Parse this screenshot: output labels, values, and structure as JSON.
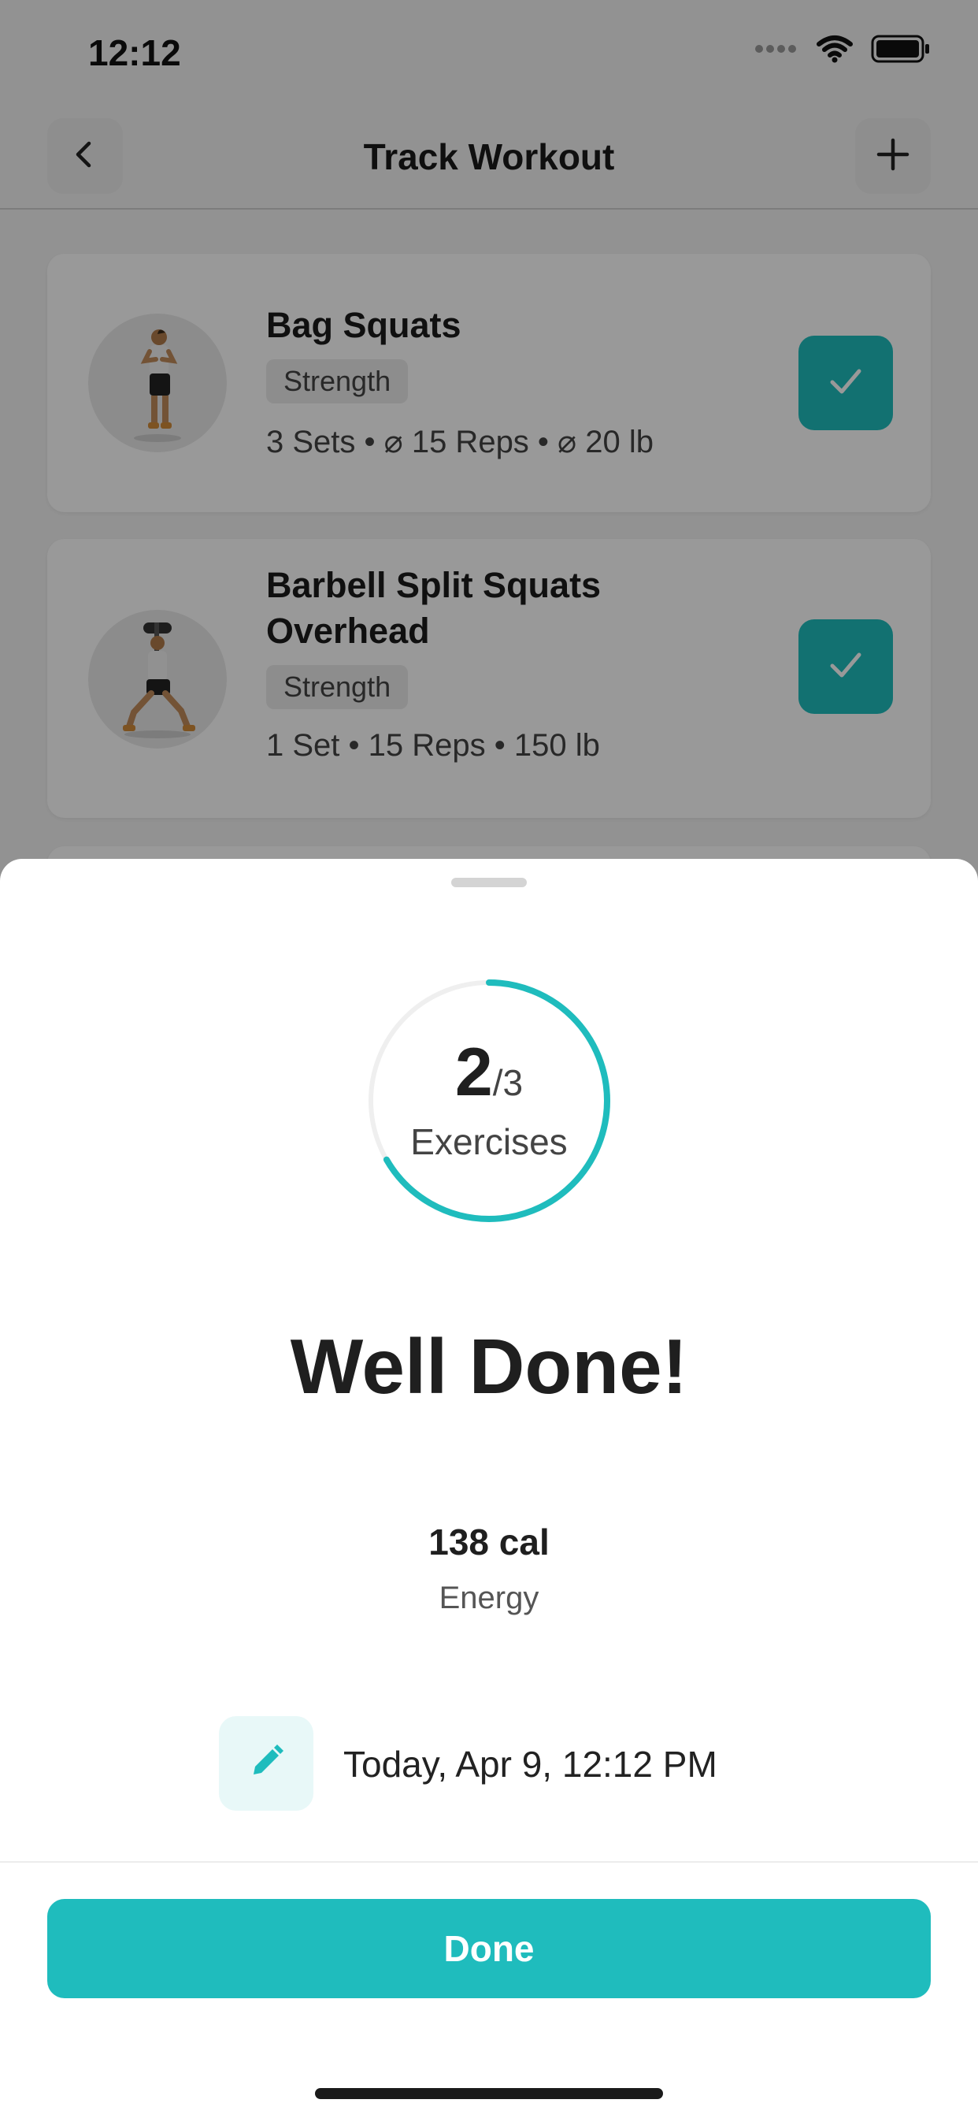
{
  "status_bar": {
    "time": "12:12",
    "signal_icon": "signal-dots-icon",
    "wifi_icon": "wifi-icon",
    "battery_icon": "battery-icon"
  },
  "nav": {
    "title": "Track Workout",
    "back_icon": "chevron-left-icon",
    "add_icon": "plus-icon"
  },
  "exercises": [
    {
      "name": "Bag Squats",
      "category": "Strength",
      "stats": "3 Sets • ⌀ 15 Reps • ⌀ 20 lb",
      "completed": true
    },
    {
      "name": "Barbell Split Squats Overhead",
      "category": "Strength",
      "stats": "1 Set • 15 Reps • 150 lb",
      "completed": true
    }
  ],
  "summary": {
    "completed_count": "2",
    "total_count": "/3",
    "progress_fraction": 0.6667,
    "unit_label": "Exercises",
    "headline": "Well Done!",
    "energy_value": "138 cal",
    "energy_label": "Energy",
    "date_text": "Today, Apr 9, 12:12 PM",
    "edit_icon": "pencil-icon",
    "done_label": "Done"
  },
  "colors": {
    "accent": "#1fbcbd",
    "accent_light": "#e8f8f8",
    "text_primary": "#1f1f1f"
  }
}
